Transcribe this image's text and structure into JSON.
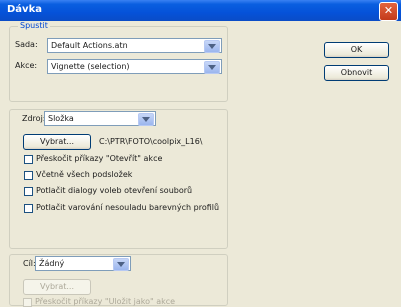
{
  "window": {
    "title": "Dávka",
    "close_glyph": "✕"
  },
  "buttons": {
    "ok": "OK",
    "reset": "Obnovit"
  },
  "play_group": {
    "legend": "Spustit",
    "set_label": "Sada:",
    "set_value": "Default Actions.atn",
    "action_label": "Akce:",
    "action_value": "Vignette (selection)"
  },
  "source_group": {
    "source_label": "Zdroj:",
    "source_value": "Složka",
    "choose_button": "Vybrat...",
    "path": "C:\\PTR\\FOTO\\coolpix_L16\\",
    "options": [
      "Přeskočit příkazy \"Otevřít\" akce",
      "Včetně všech podsložek",
      "Potlačit dialogy voleb otevření souborů",
      "Potlačit varování nesouladu barevných profilů"
    ]
  },
  "dest_group": {
    "dest_label": "Cíl:",
    "dest_value": "Žádný",
    "choose_button": "Vybrat...",
    "option": "Přeskočit příkazy \"Uložit jako\" akce"
  },
  "icons": {
    "dropdown": "chevron-down-icon",
    "close": "close-icon"
  }
}
